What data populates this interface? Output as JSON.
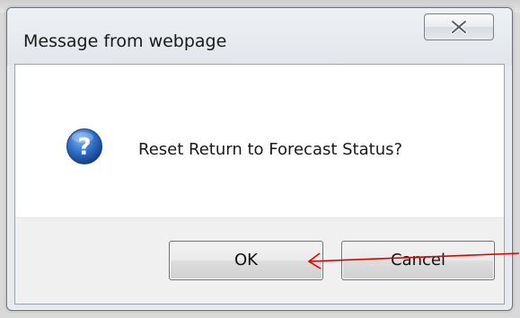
{
  "dialog": {
    "title": "Message from webpage",
    "close_icon": "close-icon",
    "message": "Reset Return to Forecast Status?",
    "message_icon": "question-icon",
    "buttons": {
      "ok_label": "OK",
      "cancel_label": "Cancel"
    }
  },
  "annotation": {
    "arrow_color": "#e00000"
  },
  "colors": {
    "question_icon_blue": "#1e5fb8",
    "dialog_frame": "#e6eaee"
  }
}
